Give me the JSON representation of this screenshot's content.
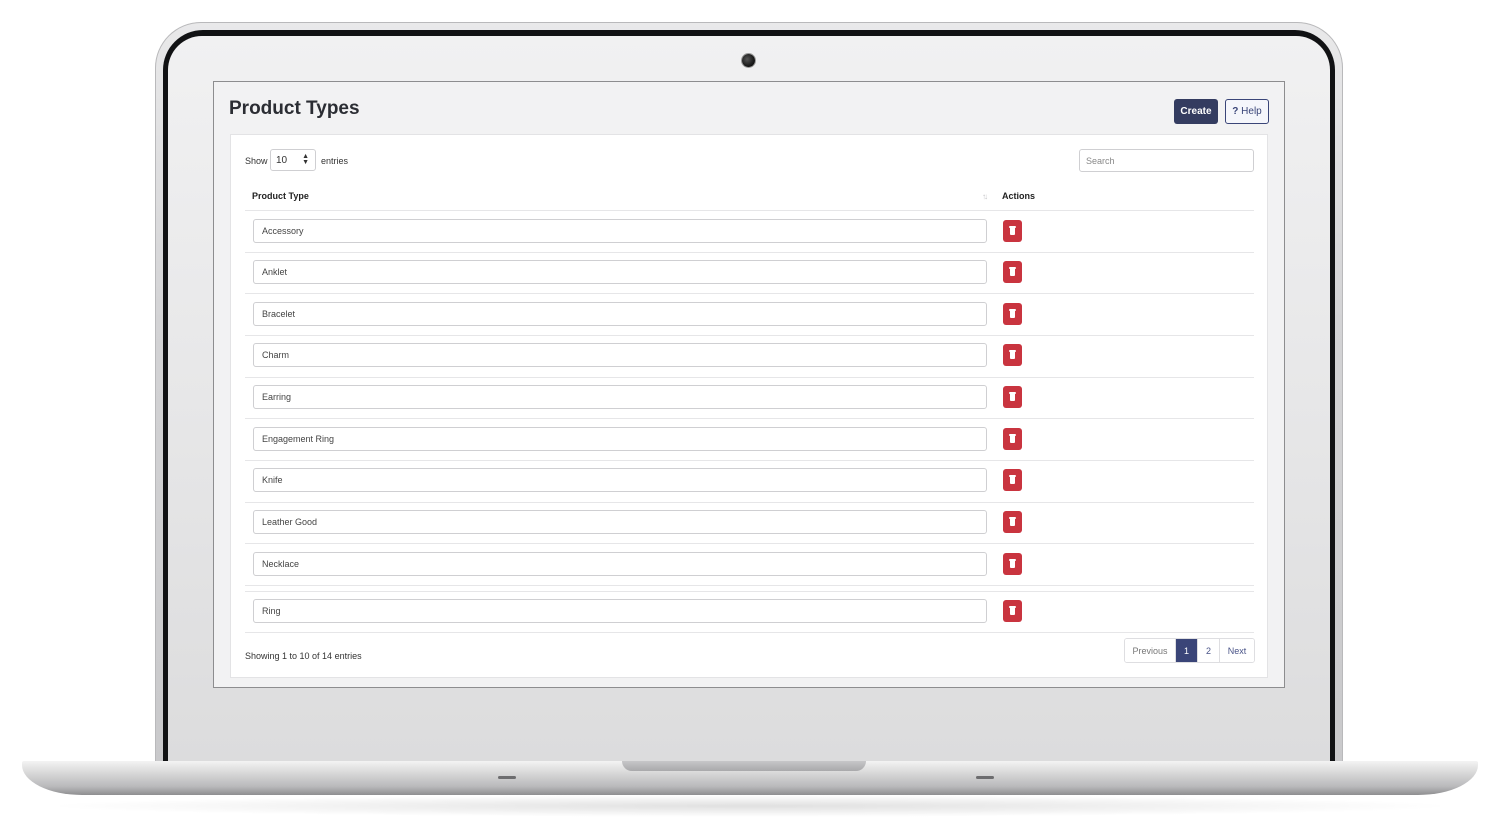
{
  "page": {
    "title": "Product Types"
  },
  "toolbar": {
    "create_label": "Create",
    "help_mark": "?",
    "help_label": "Help"
  },
  "length_menu": {
    "show_label": "Show",
    "value": "10",
    "entries_label": "entries"
  },
  "search": {
    "placeholder": "Search",
    "value": ""
  },
  "table": {
    "columns": [
      "Product Type",
      "Actions"
    ],
    "rows": [
      {
        "value": "Accessory"
      },
      {
        "value": "Anklet"
      },
      {
        "value": "Bracelet"
      },
      {
        "value": "Charm"
      },
      {
        "value": "Earring"
      },
      {
        "value": "Engagement Ring"
      },
      {
        "value": "Knife"
      },
      {
        "value": "Leather Good"
      },
      {
        "value": "Necklace"
      },
      {
        "value": "Ring"
      }
    ]
  },
  "footer": {
    "info": "Showing 1 to 10 of 14 entries",
    "pagination": {
      "previous": "Previous",
      "pages": [
        "1",
        "2"
      ],
      "next": "Next"
    }
  },
  "colors": {
    "primary": "#343c60",
    "danger": "#c9343f",
    "screen_bg": "#f2f2f3"
  }
}
